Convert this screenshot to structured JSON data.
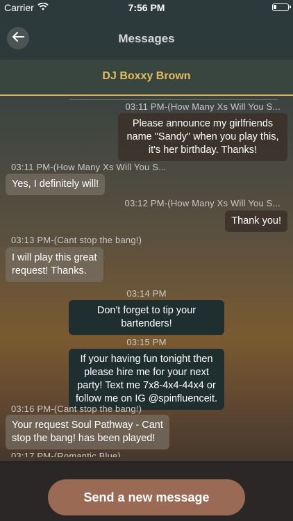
{
  "status_bar": {
    "carrier": "Carrier",
    "time": "7:56 PM"
  },
  "nav": {
    "title": "Messages",
    "back_icon": "arrow-left-icon"
  },
  "dj": {
    "name": "DJ Boxxy Brown"
  },
  "messages": [
    {
      "meta": "03:11 PM-(How Many Xs Will You S...",
      "text": [
        "Please announce my girlfriends",
        "name \"Sandy\" when you play this,",
        "it's her birthday. Thanks!"
      ]
    },
    {
      "meta": "03:11 PM-(How Many Xs Will You S...",
      "text": [
        "Yes, I definitely will!"
      ]
    },
    {
      "meta": "03:12 PM-(How Many Xs Will You S...",
      "text": [
        "Thank you!"
      ]
    },
    {
      "meta": "03:13 PM-(Cant stop the bang!)",
      "text": [
        "I will play this great",
        "request! Thanks."
      ]
    },
    {
      "meta": "03:14 PM",
      "text": [
        "Don't forget to tip your",
        "bartenders!"
      ]
    },
    {
      "meta": "03:15 PM",
      "text": [
        "If your having fun tonight then",
        "please hire me for your next",
        "party! Text me 7x8-4x4-44x4 or",
        "follow me on IG @spinfluenceit."
      ]
    },
    {
      "meta": "03:16 PM-(Cant stop the bang!)",
      "text": [
        "Your request Soul Pathway - Cant",
        "stop the bang! has been played!"
      ]
    },
    {
      "meta": "03:17 PM-(Romantic Blue)"
    }
  ],
  "bottom": {
    "send_label": "Send a new message"
  }
}
